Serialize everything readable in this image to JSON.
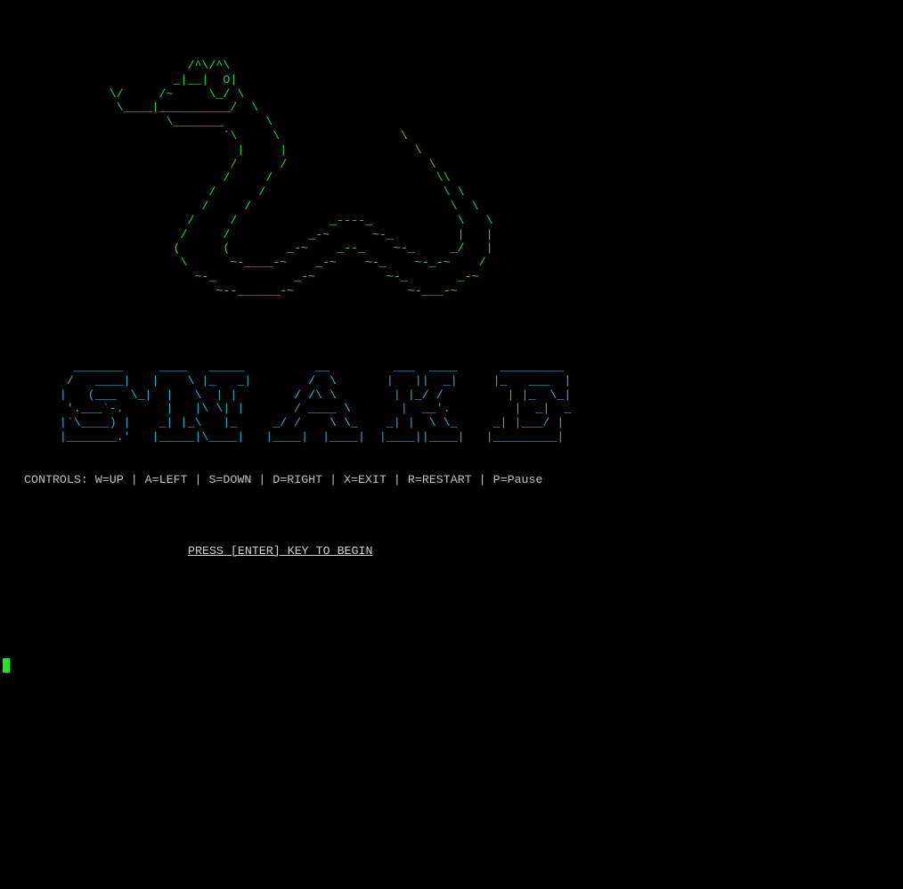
{
  "terminal": {
    "snake_ascii_art": "                          /^\\/^\\\n                        _|__|  O|\n               \\/     /~     \\_/ \\\n                \\____|__________/  \\\n                       \\_______      \\\n                               `\\     \\                 \\\n                                 |     |                  \\\n                                /      /                    \\\n                               /     /                       \\\\\n                             /      /                         \\ \\\n                            /     /                            \\  \\\n                          /     /             _----_            \\   \\\n                         /     /           _-~      ~-_         |   |\n                        (      (        _-~    _--_    ~-_     _/   |\n                         \\      ~-____-~    _-~    ~-_    ~-_-~    /\n                           ~-_           _-~          ~-_       _-~\n                              ~--______-~                ~-___-~",
    "title_ascii_art": "          _______     ____   _____          __         ___  ____      _________\n         /   ____|   |    \\ |_   _|        /  \\       |   ||  _|     |_   ___  |\n        |   (___  \\_|  |   \\  | |        / /\\ \\        | |_/ /         | |_  \\_|\n         '.___`-.      |   |\\ \\| |       / ____ \\       |  __'.         |  _|  _\n        |`\\____) |    _| |_\\   |_     _/ /    \\ \\_    _| |  \\ \\_     _| |___/ |\n        |_______.'   |_____|\\____|   |____|  |____|  |____||____|   |_________|",
    "controls_text": "CONTROLS: W=UP | A=LEFT | S=DOWN | D=RIGHT | X=EXIT | R=RESTART | P=Pause",
    "start_prompt": "PRESS [ENTER] KEY TO BEGIN"
  },
  "colors": {
    "background": "#000000",
    "snake_art": "#22d64b",
    "title_art": "#2bb3cf",
    "text": "#c0c0c0",
    "cursor": "#1ee81e"
  }
}
